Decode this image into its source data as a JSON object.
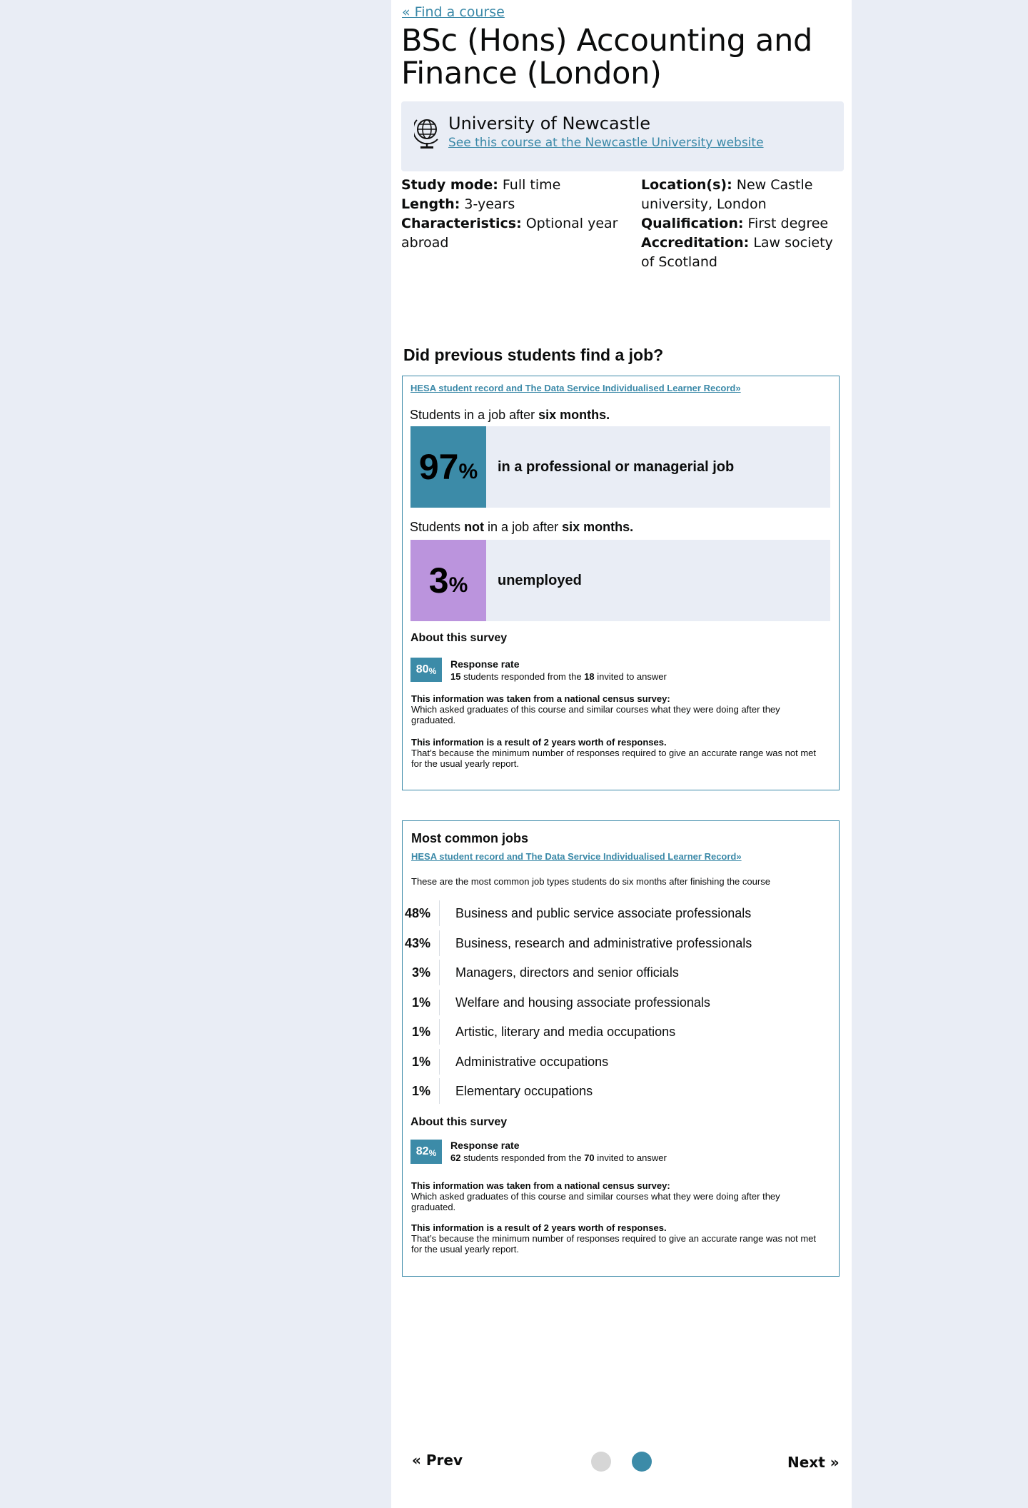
{
  "nav": {
    "back_link": "« Find a course"
  },
  "course": {
    "title": "BSc (Hons) Accounting and Finance (London)",
    "university": "University of Newcastle",
    "university_link": "See this course at the Newcastle University website",
    "facts_left": [
      {
        "label": "Study mode:",
        "value": "Full time"
      },
      {
        "label": "Length:",
        "value": "3-years"
      },
      {
        "label": "Characteristics:",
        "value": "Optional year abroad"
      }
    ],
    "facts_right": [
      {
        "label": "Location(s):",
        "value": "New Castle university, London"
      },
      {
        "label": "Qualification:",
        "value": "First degree"
      },
      {
        "label": "Accreditation:",
        "value": "Law society of Scotland"
      }
    ]
  },
  "job_section": {
    "heading": "Did previous students find a job?",
    "source_link": "HESA student record and The Data Service Individualised Learner Record»",
    "in_job_lead": {
      "pre": "Students in a job after ",
      "bold": "six months."
    },
    "in_job": {
      "value": "97",
      "unit": "%",
      "label": "in a professional or managerial job"
    },
    "not_in_job_lead": {
      "pre": "Students ",
      "bold_not": "not",
      "mid": " in a job after ",
      "bold": "six months."
    },
    "not_in_job": {
      "value": "3",
      "unit": "%",
      "label": "unemployed"
    },
    "about": {
      "heading": "About this survey",
      "rate_value": "80",
      "rate_unit": "%",
      "rate_title": "Response rate",
      "responded": "15",
      "responded_text": " students responded from the ",
      "invited": "18",
      "invited_text": " invited to answer",
      "note1_title": "This information was taken from a national census survey:",
      "note1_text": "Which asked graduates of this course and similar courses what they were doing after they graduated.",
      "note2_title": "This information is a result of 2 years worth of responses.",
      "note2_text": "That’s because the minimum number of responses required to give an accurate range was not met for the usual yearly report."
    }
  },
  "common_jobs": {
    "title": "Most common jobs",
    "source_link": "HESA student record and The Data Service Individualised Learner Record»",
    "intro": "These are the most common job types students do six months after finishing the course",
    "jobs": [
      {
        "pct": "48%",
        "name": "Business and public service associate professionals"
      },
      {
        "pct": "43%",
        "name": "Business, research and administrative professionals"
      },
      {
        "pct": "3%",
        "name": "Managers, directors and senior officials"
      },
      {
        "pct": "1%",
        "name": "Welfare and housing associate professionals"
      },
      {
        "pct": "1%",
        "name": "Artistic, literary and media occupations"
      },
      {
        "pct": "1%",
        "name": "Administrative occupations"
      },
      {
        "pct": "1%",
        "name": "Elementary occupations"
      }
    ],
    "about": {
      "heading": "About this survey",
      "rate_value": "82",
      "rate_unit": "%",
      "rate_title": "Response rate",
      "responded": "62",
      "responded_text": " students responded from the ",
      "invited": "70",
      "invited_text": " invited to answer",
      "note1_title": "This information was taken from a national census survey:",
      "note1_text": "Which asked graduates of this course and similar courses what they were doing after they graduated.",
      "note2_title": "This information is a result of 2 years worth of responses.",
      "note2_text": "That’s because the minimum number of responses required to give an accurate range was not met for the usual yearly report."
    }
  },
  "pager": {
    "prev": "« Prev",
    "next": "Next »",
    "current_page": 2,
    "total_pages": 2
  },
  "colors": {
    "accent": "#3c8ba8",
    "unemployed": "#bb94dd",
    "panel_bg": "#e9edf5"
  }
}
